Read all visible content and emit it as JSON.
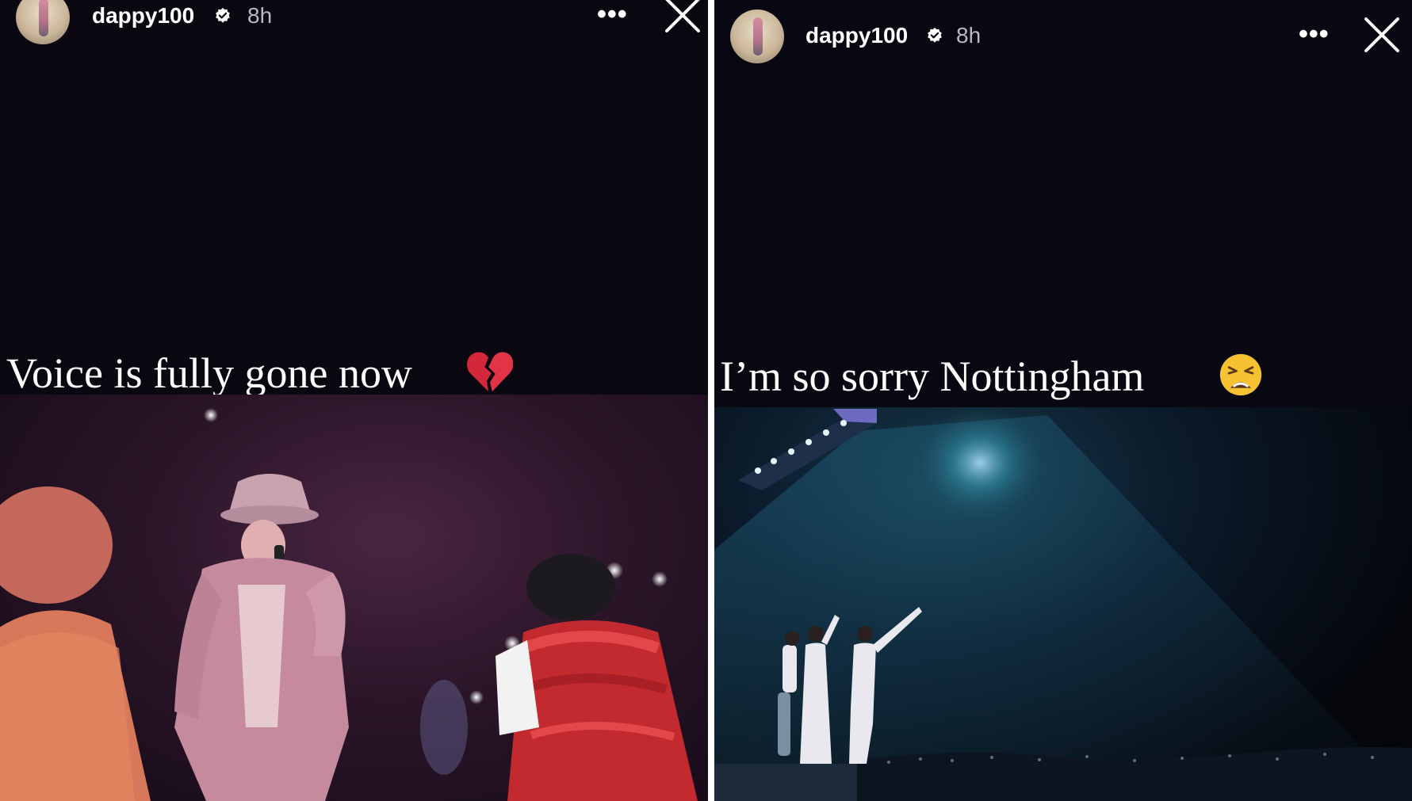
{
  "stories": [
    {
      "username": "dappy100",
      "time": "8h",
      "caption": "Voice is fully gone now",
      "emoji": "broken-heart-emoji"
    },
    {
      "username": "dappy100",
      "time": "8h",
      "caption": "I’m so sorry Nottingham",
      "emoji": "weary-face-emoji"
    }
  ],
  "more_label": "•••",
  "colors": {
    "background": "#0b0710",
    "accent": "#ffffff"
  }
}
